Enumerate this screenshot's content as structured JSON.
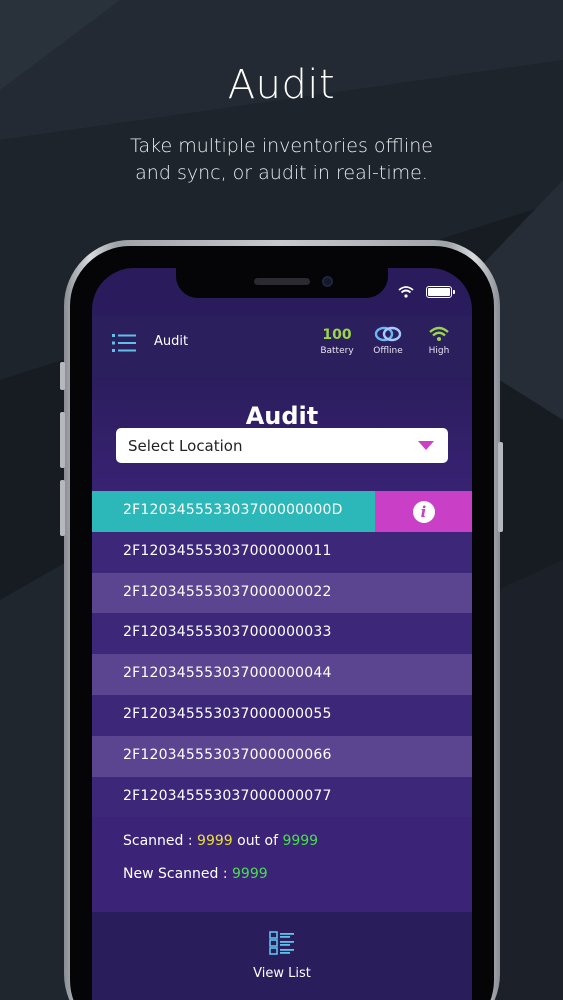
{
  "hero": {
    "title": "Audit",
    "subtitle": "Take multiple inventories offline\nand sync, or audit in real-time."
  },
  "app": {
    "title": "Audit",
    "stats": [
      {
        "value": "100",
        "label": "Battery",
        "icon": "battery-value"
      },
      {
        "value": "",
        "label": "Offline",
        "icon": "link-icon"
      },
      {
        "value": "",
        "label": "High",
        "icon": "wifi-signal-icon"
      }
    ]
  },
  "page": {
    "title": "Audit",
    "select": {
      "value": "Select Location"
    }
  },
  "tags": [
    "2F120345553303700000000D",
    "2F120345553037000000011",
    "2F120345553037000000022",
    "2F120345553037000000033",
    "2F120345553037000000044",
    "2F120345553037000000055",
    "2F120345553037000000066",
    "2F120345553037000000077"
  ],
  "counts": {
    "scanned_label": "Scanned : ",
    "scanned": "9999",
    "out_of": " out of ",
    "total": "9999",
    "new_label": "New Scanned : ",
    "new": "9999"
  },
  "bottom": {
    "view_list_label": "View List"
  },
  "colors": {
    "accent_teal": "#2cb8b8",
    "accent_magenta": "#c93fc6",
    "panel_purple": "#3b2378",
    "good_green": "#9bd34a",
    "count_yellow": "#e9e03a"
  }
}
